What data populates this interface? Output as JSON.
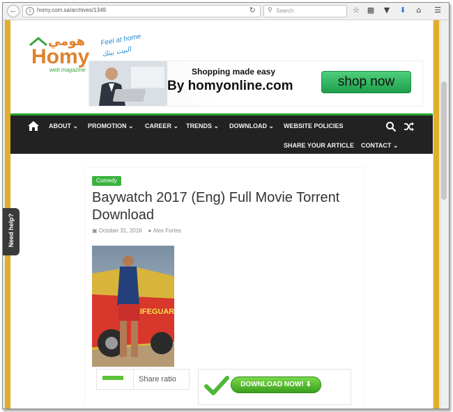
{
  "browser": {
    "url": "homy.com.sa/archives/1349",
    "search_placeholder": "Search",
    "icons": [
      "back-icon",
      "info-icon",
      "reload-icon",
      "search-icon",
      "bookmark-star-icon",
      "library-icon",
      "pocket-icon",
      "download-icon",
      "home-icon",
      "menu-icon"
    ]
  },
  "site": {
    "logo": {
      "arabic": "هومي",
      "name": "Homy",
      "sub": "web magazine",
      "tagline_en": "Feel at home",
      "tagline_ar": "البيت بيتك"
    },
    "ad": {
      "line1": "Shopping made easy",
      "line2": "By homyonline.com",
      "button": "shop now"
    },
    "nav": {
      "items": [
        "ABOUT",
        "PROMOTION",
        "CAREER",
        "TRENDS",
        "DOWNLOAD",
        "WEBSITE POLICIES",
        "SHARE YOUR ARTICLE",
        "CONTACT"
      ],
      "icons": [
        "home-icon",
        "search-icon",
        "shuffle-icon"
      ]
    },
    "article": {
      "category": "Comedy",
      "title": "Baywatch 2017 (Eng) Full Movie Torrent Download",
      "date": "October 31, 2016",
      "author": "Alex Fortes",
      "poster_text": "LIFEGUARD",
      "share_label": "Share ratio",
      "download_label": "DOWNLOAD NOW!"
    },
    "help_tab": "Need help?"
  },
  "colors": {
    "accent_green": "#3ab33f",
    "nav_bg": "#222222",
    "side_stripe": "#e2ad2a"
  }
}
